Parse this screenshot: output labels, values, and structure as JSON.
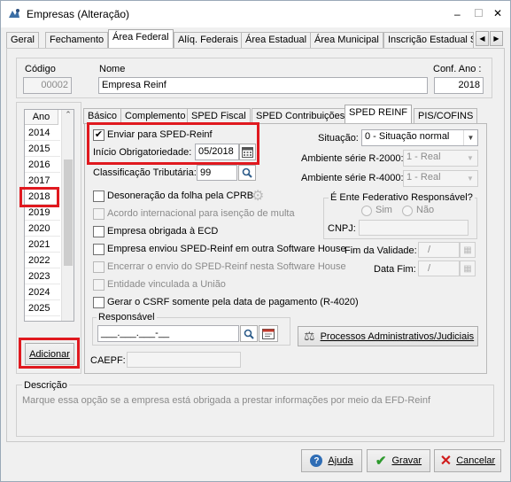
{
  "window": {
    "title": "Empresas (Alteração)",
    "minimize": "–",
    "maximize": "☐",
    "close": "✕"
  },
  "top_tabs": [
    "Geral",
    "Fechamento",
    "Área Federal",
    "Alíq. Federais",
    "Área Estadual",
    "Área Municipal",
    "Inscrição Estadual S"
  ],
  "header": {
    "codigo_label": "Código",
    "codigo_value": "00002",
    "nome_label": "Nome",
    "nome_value": "Empresa Reinf",
    "conf_ano_label": "Conf. Ano :",
    "conf_ano_value": "2018"
  },
  "years": {
    "header": "Ano",
    "items": [
      "2014",
      "2015",
      "2016",
      "2017",
      "2018",
      "2019",
      "2020",
      "2021",
      "2022",
      "2023",
      "2024",
      "2025"
    ],
    "selected": "2018",
    "add_button": "Adicionar"
  },
  "sub_tabs": [
    "Básico",
    "Complemento",
    "SPED Fiscal",
    "SPED Contribuições",
    "SPED REINF",
    "PIS/COFINS"
  ],
  "reinf": {
    "enviar_label": "Enviar para SPED-Reinf",
    "inicio_label": "Início Obrigatoriedade:",
    "inicio_value": "05/2018",
    "classificacao_label": "Classificação Tributária:",
    "classificacao_value": "99",
    "checks": [
      "Desoneração da folha pela CPRB",
      "Acordo internacional para isenção de multa",
      "Empresa obrigada à ECD",
      "Empresa enviou SPED-Reinf em outra Software House",
      "Encerrar o envio do SPED-Reinf nesta Software House",
      "Entidade vinculada a União",
      "Gerar o CSRF somente pela data de pagamento (R-4020)"
    ],
    "situacao_label": "Situação:",
    "situacao_value": "0 - Situação normal",
    "amb2000_label": "Ambiente série R-2000:",
    "amb2000_value": "1 - Real",
    "amb4000_label": "Ambiente série R-4000:",
    "amb4000_value": "1 - Real",
    "ente_label": "É Ente Federativo Responsável?",
    "sim": "Sim",
    "nao": "Não",
    "cnpj_label": "CNPJ:",
    "fim_validade_label": "Fim da Validade:",
    "fim_validade_value": "/",
    "data_fim_label": "Data Fim:",
    "data_fim_value": "/",
    "responsavel_label": "Responsável",
    "responsavel_value": "___.___.___-__",
    "processos_button": "Processos Administrativos/Judiciais",
    "caepf_label": "CAEPF:"
  },
  "descricao": {
    "label": "Descrição",
    "text": "Marque essa opção se a empresa está obrigada a prestar informações por meio da EFD-Reinf"
  },
  "footer": {
    "ajuda": "Ajuda",
    "gravar": "Gravar",
    "cancelar": "Cancelar"
  },
  "colors": {
    "highlight": "#e0191f",
    "tab_selected": "#ffffff",
    "window_bg": "#f0f0f0"
  }
}
